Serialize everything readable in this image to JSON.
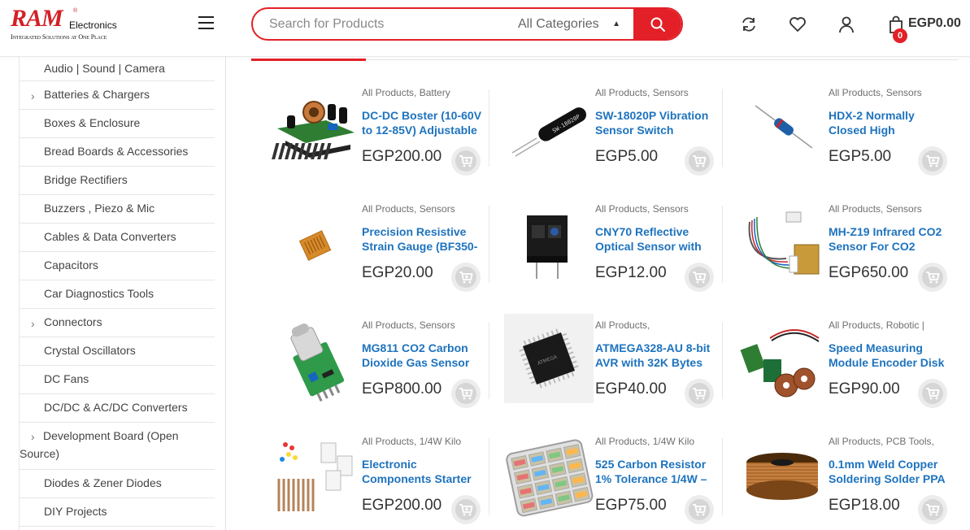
{
  "logo": {
    "brand": "RAM",
    "reg": "®",
    "suffix": "Electronics",
    "tagline": "Integrated Solutions at One Place"
  },
  "search": {
    "placeholder": "Search for Products",
    "category": "All Categories"
  },
  "header": {
    "cart_count": "0",
    "cart_total": "EGP0.00"
  },
  "colors": {
    "accent": "#e32027",
    "link": "#1e73be"
  },
  "sidebar": {
    "items": [
      {
        "label": "Audio | Sound | Camera",
        "has_children": false
      },
      {
        "label": "Batteries & Chargers",
        "has_children": true
      },
      {
        "label": "Boxes & Enclosure",
        "has_children": false
      },
      {
        "label": "Bread Boards & Accessories",
        "has_children": false
      },
      {
        "label": "Bridge Rectifiers",
        "has_children": false
      },
      {
        "label": "Buzzers , Piezo & Mic",
        "has_children": false
      },
      {
        "label": "Cables & Data Converters",
        "has_children": false
      },
      {
        "label": "Capacitors",
        "has_children": false
      },
      {
        "label": "Car Diagnostics Tools",
        "has_children": false
      },
      {
        "label": "Connectors",
        "has_children": true
      },
      {
        "label": "Crystal Oscillators",
        "has_children": false
      },
      {
        "label": "DC Fans",
        "has_children": false
      },
      {
        "label": "DC/DC & AC/DC Converters",
        "has_children": false
      },
      {
        "label": "Development Board (Open Source)",
        "has_children": true
      },
      {
        "label": "Diodes & Zener Diodes",
        "has_children": false
      },
      {
        "label": "DIY Projects",
        "has_children": false
      }
    ]
  },
  "products": [
    {
      "categories": "All Products, Battery",
      "name": "DC-DC Boster (10-60V to 12-85V) Adjustable",
      "price": "EGP200.00",
      "image": "dc-dc-converter-module"
    },
    {
      "categories": "All Products, Sensors",
      "name": "SW-18020P Vibration Sensor Switch",
      "price": "EGP5.00",
      "image": "vibration-sensor-switch"
    },
    {
      "categories": "All Products, Sensors",
      "name": "HDX-2 Normally Closed High",
      "price": "EGP5.00",
      "image": "tilt-switch"
    },
    {
      "categories": "All Products, Sensors",
      "name": "Precision Resistive Strain Gauge (BF350-",
      "price": "EGP20.00",
      "image": "strain-gauge"
    },
    {
      "categories": "All Products, Sensors",
      "name": "CNY70 Reflective Optical Sensor with",
      "price": "EGP12.00",
      "image": "optical-sensor"
    },
    {
      "categories": "All Products, Sensors",
      "name": "MH-Z19 Infrared CO2 Sensor For CO2",
      "price": "EGP650.00",
      "image": "co2-sensor-module"
    },
    {
      "categories": "All Products, Sensors",
      "name": "MG811 CO2 Carbon Dioxide Gas Sensor",
      "price": "EGP800.00",
      "image": "gas-sensor-board"
    },
    {
      "categories": "All Products,",
      "name": "ATMEGA328-AU 8-bit AVR with 32K Bytes",
      "price": "EGP40.00",
      "image": "microcontroller-chip"
    },
    {
      "categories": "All Products, Robotic |",
      "name": "Speed Measuring Module Encoder Disk",
      "price": "EGP90.00",
      "image": "encoder-module"
    },
    {
      "categories": "All Products, 1/4W Kilo",
      "name": "Electronic Components Starter",
      "price": "EGP200.00",
      "image": "components-kit"
    },
    {
      "categories": "All Products, 1/4W Kilo",
      "name": "525 Carbon Resistor 1% Tolerance 1/4W –",
      "price": "EGP75.00",
      "image": "resistor-box"
    },
    {
      "categories": "All Products, PCB Tools,",
      "name": "0.1mm Weld Copper Soldering Solder PPA",
      "price": "EGP18.00",
      "image": "copper-wire-spool"
    }
  ]
}
